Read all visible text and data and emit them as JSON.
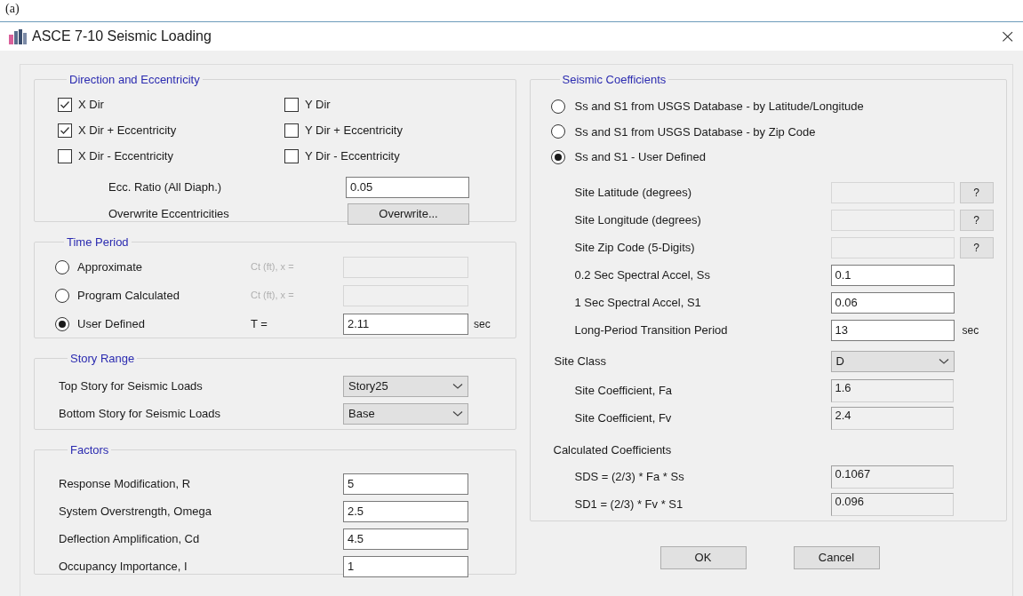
{
  "caption": "(a)",
  "window": {
    "title": "ASCE 7-10 Seismic Loading",
    "close": "×"
  },
  "direction": {
    "title": "Direction and Eccentricity",
    "checkboxes": [
      {
        "label": "X Dir",
        "checked": true
      },
      {
        "label": "Y Dir",
        "checked": false
      },
      {
        "label": "X Dir + Eccentricity",
        "checked": true
      },
      {
        "label": "Y Dir + Eccentricity",
        "checked": false
      },
      {
        "label": "X Dir - Eccentricity",
        "checked": false
      },
      {
        "label": "Y Dir - Eccentricity",
        "checked": false
      }
    ],
    "ecc_ratio": {
      "label": "Ecc. Ratio (All Diaph.)",
      "value": "0.05"
    },
    "overwrite": {
      "label": "Overwrite Eccentricities",
      "button": "Overwrite..."
    }
  },
  "time_period": {
    "title": "Time Period",
    "options": [
      {
        "label": "Approximate",
        "selected": false,
        "param_label": "Ct (ft), x =",
        "disabled": true
      },
      {
        "label": "Program Calculated",
        "selected": false,
        "param_label": "Ct (ft), x =",
        "disabled": true
      },
      {
        "label": "User Defined",
        "selected": true,
        "param_label": "T =",
        "disabled": false,
        "value": "2.11",
        "unit": "sec"
      }
    ]
  },
  "story_range": {
    "title": "Story Range",
    "rows": [
      {
        "label": "Top Story for Seismic Loads",
        "value": "Story25"
      },
      {
        "label": "Bottom Story for Seismic Loads",
        "value": "Base"
      }
    ]
  },
  "factors": {
    "title": "Factors",
    "rows": [
      {
        "label": "Response Modification, R",
        "value": "5"
      },
      {
        "label": "System Overstrength, Omega",
        "value": "2.5"
      },
      {
        "label": "Deflection Amplification, Cd",
        "value": "4.5"
      },
      {
        "label": "Occupancy Importance, I",
        "value": "1"
      }
    ]
  },
  "seismic": {
    "title": "Seismic Coefficients",
    "options": [
      {
        "label": "Ss and S1 from USGS Database - by Latitude/Longitude",
        "selected": false
      },
      {
        "label": "Ss and S1 from USGS Database - by Zip Code",
        "selected": false
      },
      {
        "label": "Ss and S1 - User Defined",
        "selected": true
      }
    ],
    "site_fields": [
      {
        "label": "Site Latitude (degrees)",
        "disabled": true,
        "help": "?"
      },
      {
        "label": "Site Longitude (degrees)",
        "disabled": true,
        "help": "?"
      },
      {
        "label": "Site Zip Code (5-Digits)",
        "disabled": true,
        "help": "?"
      },
      {
        "label": "0.2 Sec Spectral Accel, Ss",
        "disabled": false,
        "value": "0.1"
      },
      {
        "label": "1 Sec Spectral Accel, S1",
        "disabled": false,
        "value": "0.06"
      },
      {
        "label": "Long-Period Transition Period",
        "disabled": false,
        "value": "13",
        "unit": "sec"
      }
    ],
    "site_class": {
      "label": "Site Class",
      "value": "D"
    },
    "site_coefficients": [
      {
        "label": "Site Coefficient, Fa",
        "value": "1.6"
      },
      {
        "label": "Site Coefficient, Fv",
        "value": "2.4"
      }
    ],
    "calculated": {
      "title": "Calculated Coefficients",
      "rows": [
        {
          "label": "SDS = (2/3) * Fa * Ss",
          "value": "0.1067"
        },
        {
          "label": "SD1 = (2/3) * Fv * S1",
          "value": "0.096"
        }
      ]
    }
  },
  "buttons": [
    "OK",
    "Cancel"
  ]
}
